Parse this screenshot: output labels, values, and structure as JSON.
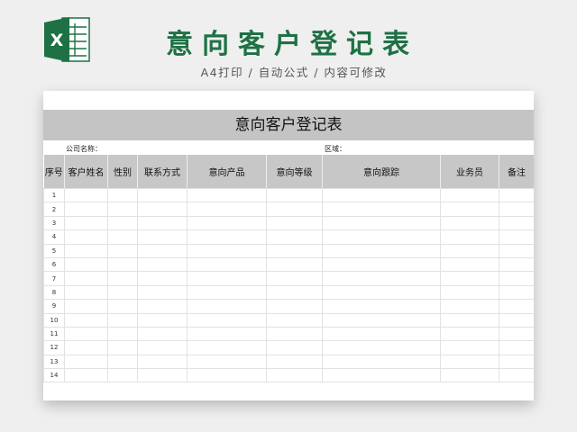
{
  "header": {
    "title": "意向客户登记表",
    "subtitle": "A4打印 / 自动公式 / 内容可修改",
    "logo_icon": "excel-icon",
    "logo_letter": "X",
    "brand_color": "#1e7145"
  },
  "sheet": {
    "title": "意向客户登记表",
    "company_label": "公司名称：",
    "region_label": "区域：",
    "columns": [
      "序号",
      "客户姓名",
      "性别",
      "联系方式",
      "意向产品",
      "意向等级",
      "意向跟踪",
      "业务员",
      "备注"
    ],
    "row_numbers": [
      "1",
      "2",
      "3",
      "4",
      "5",
      "6",
      "7",
      "8",
      "9",
      "10",
      "11",
      "12",
      "13",
      "14"
    ]
  }
}
